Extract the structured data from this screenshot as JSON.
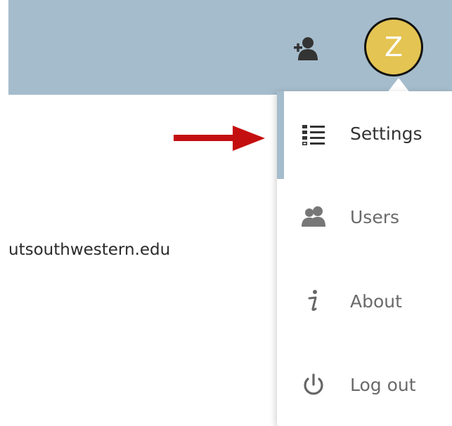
{
  "header": {
    "avatar_initial": "Z",
    "avatar_color": "#e4c452",
    "background_color": "#a5bccc",
    "user_icon": "user-add-icon"
  },
  "main": {
    "domain_text": "utsouthwestern.edu"
  },
  "annotation": {
    "arrow_color": "#c40f10"
  },
  "dropdown": {
    "items": [
      {
        "label": "Settings",
        "icon": "list-settings-icon",
        "active": true
      },
      {
        "label": "Users",
        "icon": "users-icon",
        "active": false
      },
      {
        "label": "About",
        "icon": "info-icon",
        "active": false
      },
      {
        "label": "Log out",
        "icon": "power-icon",
        "active": false
      }
    ]
  }
}
